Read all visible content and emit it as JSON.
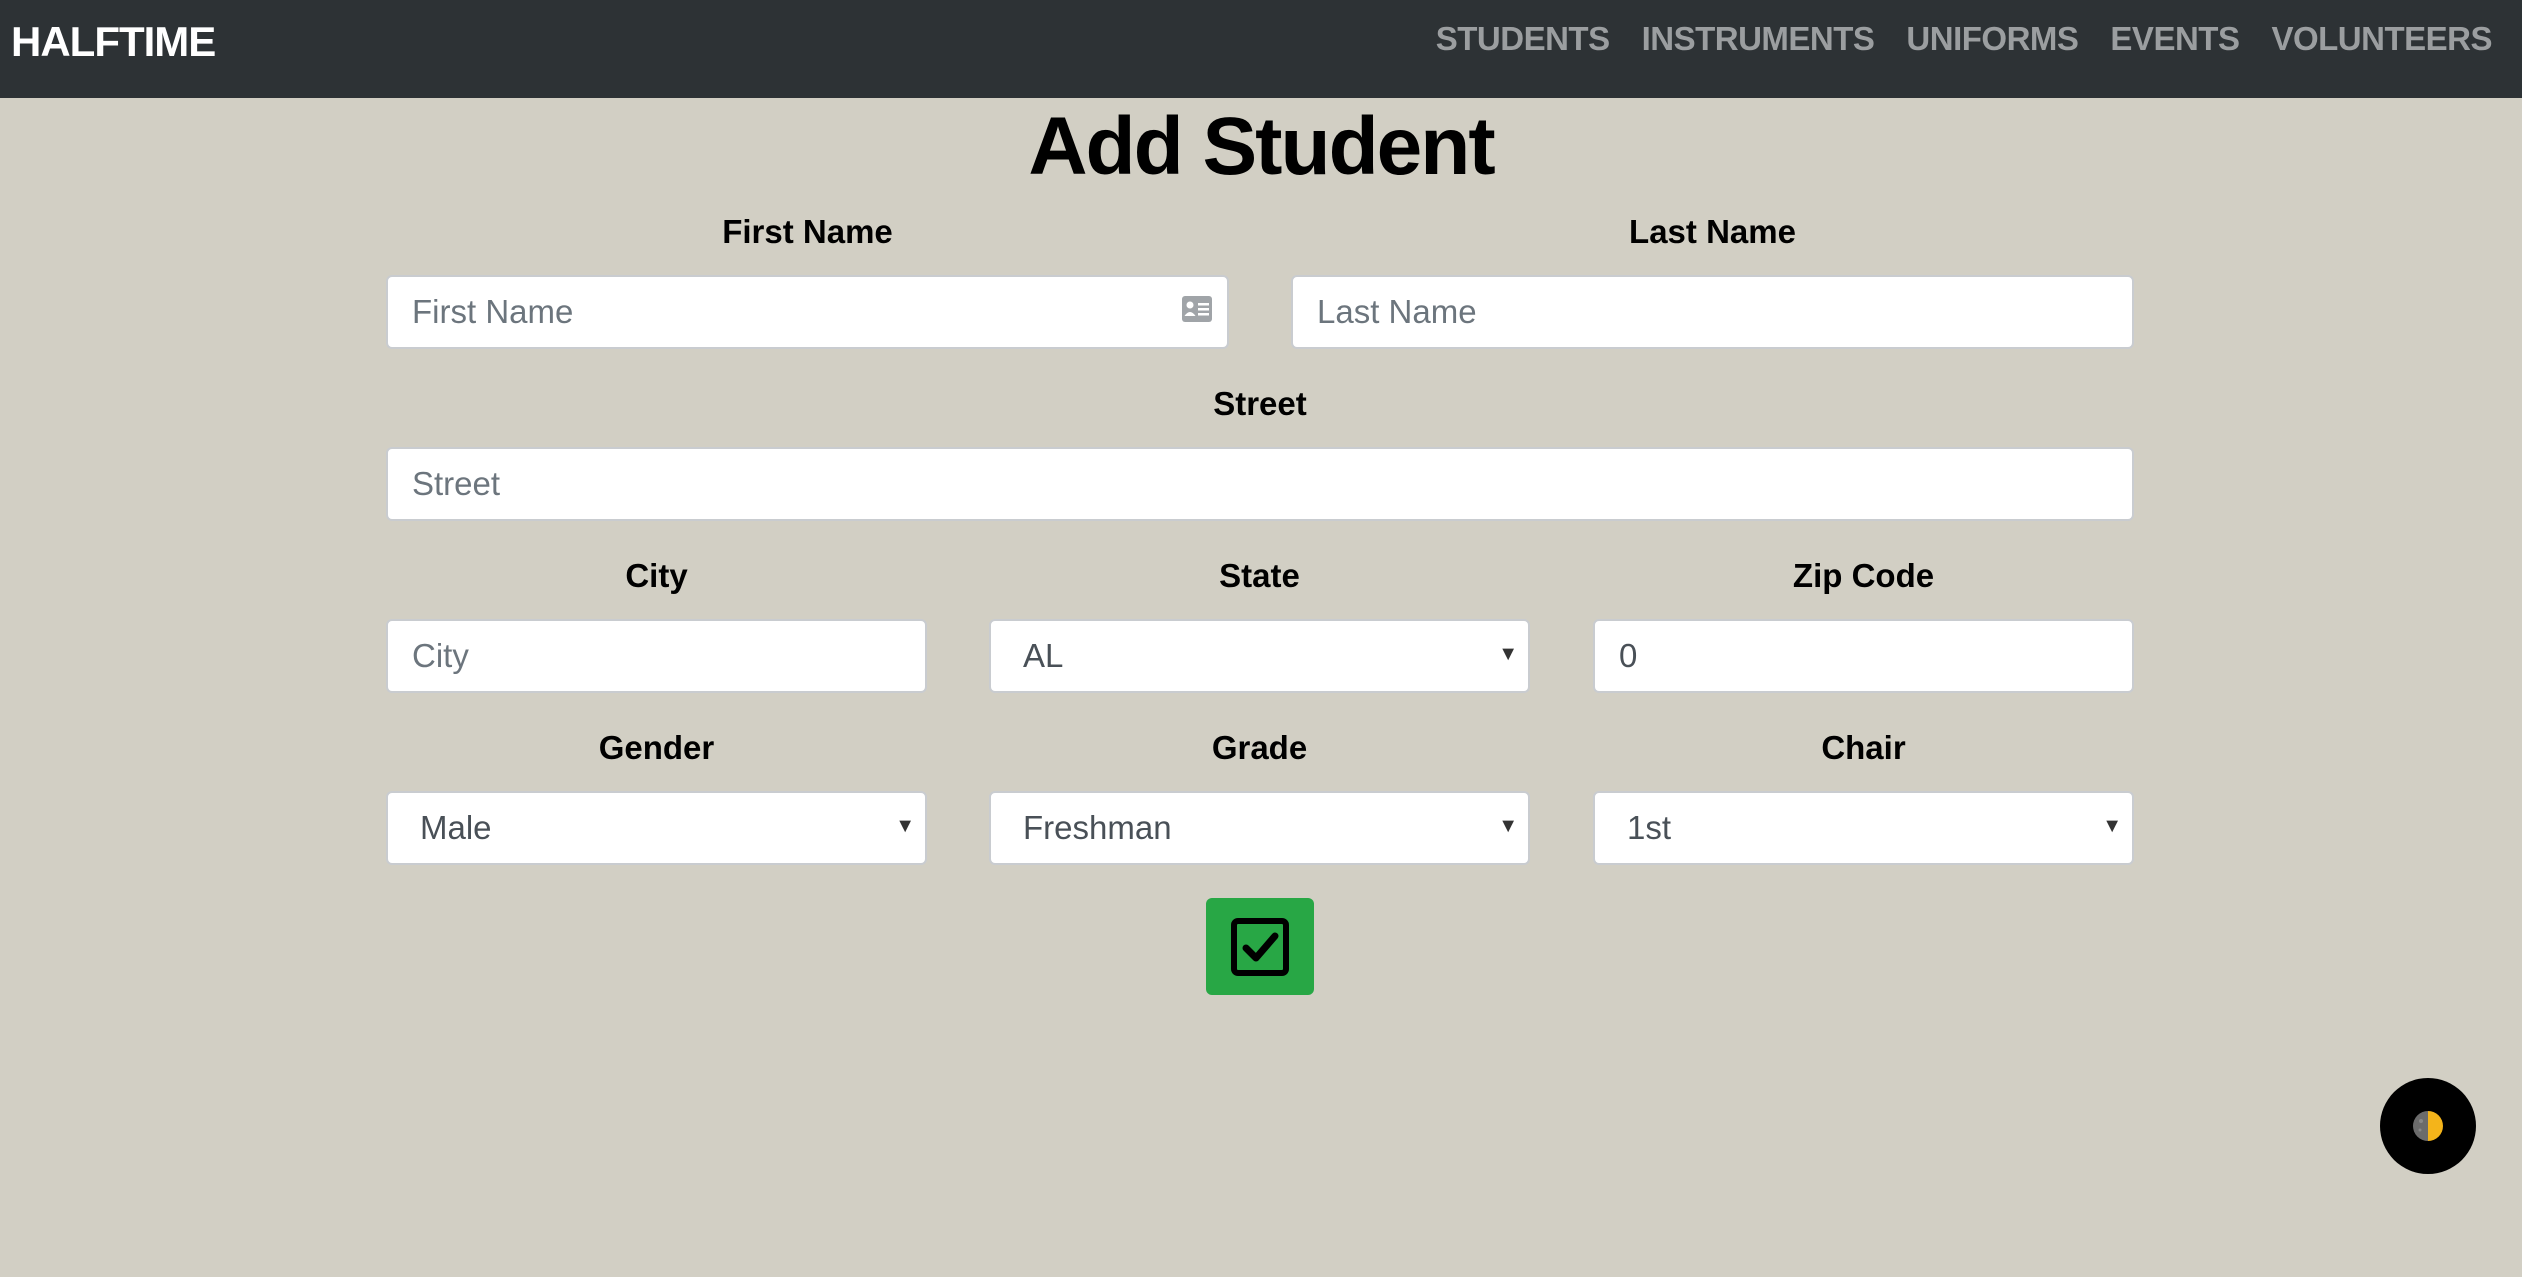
{
  "nav": {
    "brand": "HALFTIME",
    "links": [
      "STUDENTS",
      "INSTRUMENTS",
      "UNIFORMS",
      "EVENTS",
      "VOLUNTEERS"
    ]
  },
  "page": {
    "title": "Add Student"
  },
  "form": {
    "first_name": {
      "label": "First Name",
      "placeholder": "First Name"
    },
    "last_name": {
      "label": "Last Name",
      "placeholder": "Last Name"
    },
    "street": {
      "label": "Street",
      "placeholder": "Street"
    },
    "city": {
      "label": "City",
      "placeholder": "City"
    },
    "state": {
      "label": "State",
      "value": "AL"
    },
    "zip": {
      "label": "Zip Code",
      "value": "0"
    },
    "gender": {
      "label": "Gender",
      "value": "Male"
    },
    "grade": {
      "label": "Grade",
      "value": "Freshman"
    },
    "chair": {
      "label": "Chair",
      "value": "1st"
    }
  },
  "icons": {
    "submit": "check-square-icon",
    "theme": "half-circle-theme-icon",
    "card": "id-card-icon"
  },
  "colors": {
    "navbar": "#2d3235",
    "background": "#d2cfc4",
    "submit": "#28a745",
    "theme_accent": "#f4b41a"
  }
}
